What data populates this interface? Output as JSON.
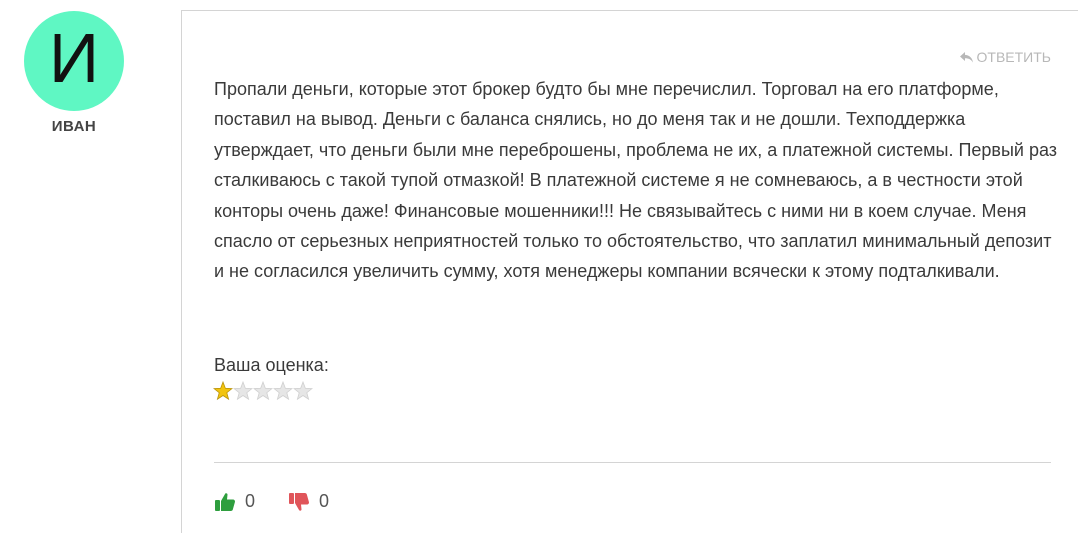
{
  "author": {
    "initial": "И",
    "name": "ИВАН",
    "avatar_color": "#5ff7c3"
  },
  "comment": {
    "reply_label": "ОТВЕТИТЬ",
    "reply_icon": "reply-arrow-icon",
    "text": "Пропали деньги, которые этот брокер будто бы мне перечислил. Торговал на его платформе, поставил на вывод. Деньги с баланса снялись, но до меня так и не дошли. Техподдержка утверждает, что деньги были мне переброшены, проблема не их, а платежной системы. Первый раз сталкиваюсь с такой тупой отмазкой! В платежной системе я не сомневаюсь, а в честности этой конторы очень даже! Финансовые мошенники!!! Не связывайтесь с ними ни в коем случае. Меня спасло от серьезных неприятностей только то обстоятельство, что заплатил минимальный депозит и не согласился увеличить сумму, хотя менеджеры компании всячески к этому подталкивали."
  },
  "rating": {
    "label": "Ваша оценка:",
    "value": 1,
    "max": 5,
    "filled_color": "#f2c40f",
    "empty_color": "#e6e6e6"
  },
  "votes": {
    "like": {
      "icon": "thumbs-up-icon",
      "count": "0",
      "color": "#2e9e3e"
    },
    "dislike": {
      "icon": "thumbs-down-icon",
      "count": "0",
      "color": "#e0555a"
    }
  }
}
